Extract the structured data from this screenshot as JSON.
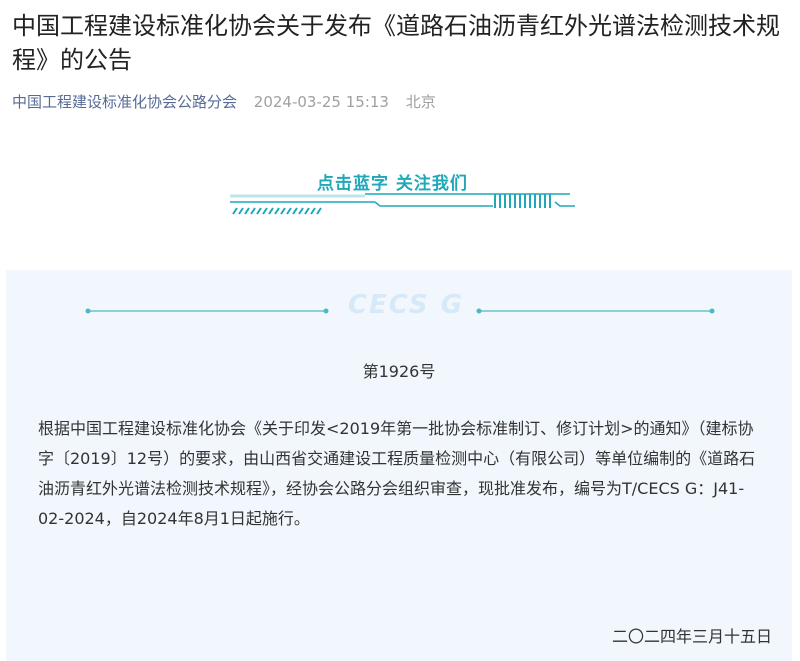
{
  "article": {
    "title": "中国工程建设标准化协会关于发布《道路石油沥青红外光谱法检测技术规程》的公告",
    "account": "中国工程建设标准化协会公路分会",
    "date": "2024-03-25 15:13",
    "location": "北京"
  },
  "follow_banner": {
    "text": "点击蓝字 关注我们"
  },
  "notice": {
    "watermark": "CECS G",
    "number": "第1926号",
    "body": "根据中国工程建设标准化协会《关于印发<2019年第一批协会标准制订、修订计划>的通知》（建标协字〔2019〕12号）的要求，由山西省交通建设工程质量检测中心（有限公司）等单位编制的《道路石油沥青红外光谱法检测技术规程》，经协会公路分会组织审查，现批准发布，编号为T/CECS G：J41-02-2024，自2024年8月1日起施行。",
    "sign_date": "二〇二四年三月十五日"
  },
  "colors": {
    "accent_teal": "#1ea8b8",
    "account_blue": "#576b95",
    "card_background": "#f1f7fc",
    "watermark": "#d6e9f8"
  }
}
